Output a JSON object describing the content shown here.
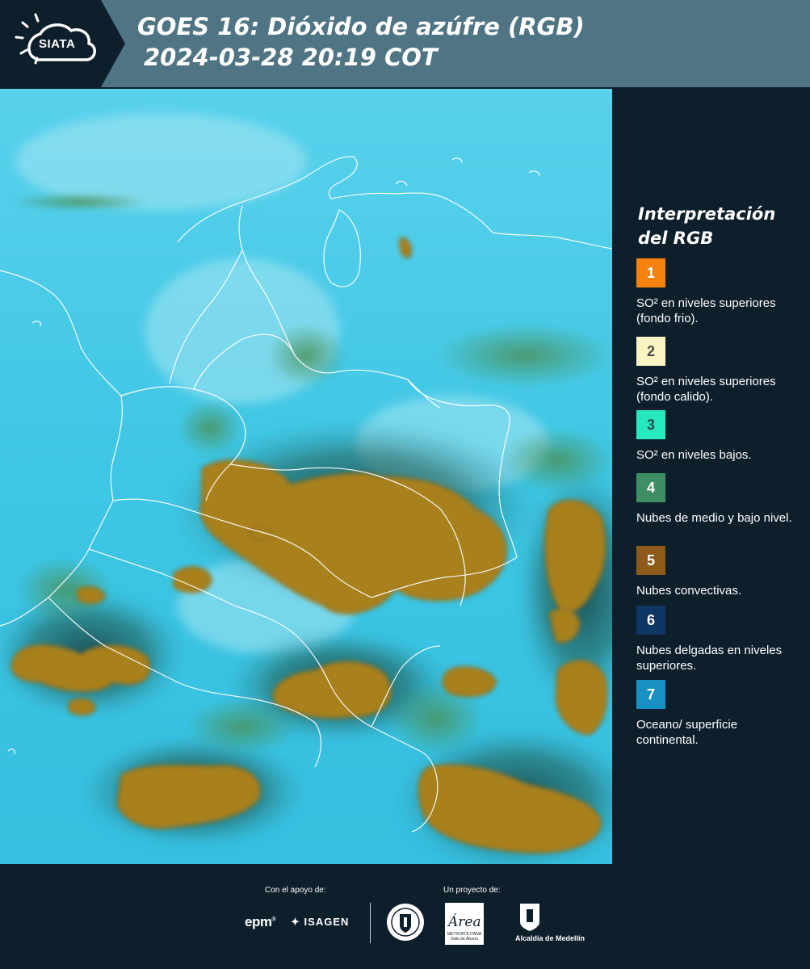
{
  "header": {
    "logo_text": "SIATA",
    "title": "GOES 16: Dióxido de azúfre (RGB)",
    "datetime": "2024-03-28 20:19 COT"
  },
  "legend": {
    "title_line1": "Interpretación",
    "title_line2": "del RGB",
    "items": [
      {
        "number": "1",
        "label": "SO² en niveles superiores (fondo frio).",
        "color": "#f5820f",
        "text_color": "#ffffff"
      },
      {
        "number": "2",
        "label": "SO² en niveles superiores (fondo calido).",
        "color": "#fbf4c2",
        "text_color": "#4a4a4a"
      },
      {
        "number": "3",
        "label": "SO² en niveles bajos.",
        "color": "#27e9c0",
        "text_color": "#20504a"
      },
      {
        "number": "4",
        "label": "Nubes de medio y bajo nivel.",
        "color": "#3f8e63",
        "text_color": "#ffffff"
      },
      {
        "number": "5",
        "label": "Nubes convectivas.",
        "color": "#8e5a17",
        "text_color": "#ffffff"
      },
      {
        "number": "6",
        "label": "Nubes delgadas en niveles superiores.",
        "color": "#0f3766",
        "text_color": "#ffffff"
      },
      {
        "number": "7",
        "label": "Oceano/ superficie continental.",
        "color": "#1790c4",
        "text_color": "#ffffff"
      }
    ]
  },
  "footer": {
    "support_label": "Con el apoyo de:",
    "project_label": "Un proyecto de:",
    "sponsor_epm": "epm",
    "sponsor_isagen": "ISAGEN",
    "area_name": "Área",
    "area_sub": "METROPOLITANA Valle de Aburrá",
    "alcaldia": "Alcaldía de Medellín"
  },
  "colors": {
    "header_bg": "#4f7584",
    "panel_bg": "#0e1f2c",
    "surface_cyan": "#3cc9e6",
    "convective_brown": "#a8801f",
    "low_cloud_green": "#3f7a45",
    "border_white": "#ffffff"
  }
}
